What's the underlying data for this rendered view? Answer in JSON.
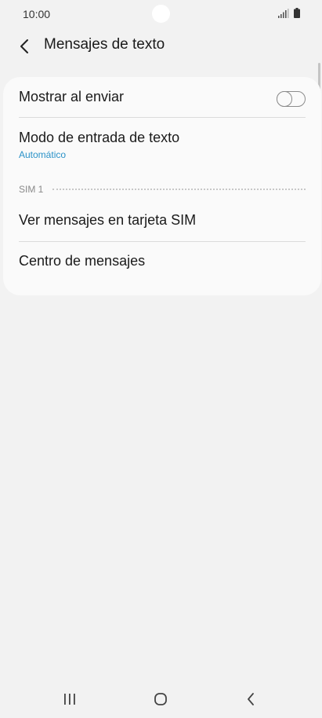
{
  "status_bar": {
    "time": "10:00",
    "signal_icon": "signal-bars-icon",
    "battery_icon": "battery-icon"
  },
  "app_bar": {
    "back_icon": "chevron-left-icon",
    "title": "Mensajes de texto"
  },
  "settings": {
    "show_when_sending": {
      "label": "Mostrar al enviar",
      "toggle_on": false
    },
    "input_mode": {
      "label": "Modo de entrada de texto",
      "value": "Automático"
    },
    "sim_section": {
      "label": "SIM 1"
    },
    "view_sim_messages": {
      "label": "Ver mensajes en tarjeta SIM"
    },
    "message_center": {
      "label": "Centro de mensajes"
    }
  },
  "nav_bar": {
    "recents_icon": "recents-icon",
    "home_icon": "home-icon",
    "back_icon": "back-icon"
  },
  "colors": {
    "background": "#f2f2f2",
    "card": "#fafafa",
    "accent": "#2a92c8",
    "section_label": "#8a8a8a"
  }
}
